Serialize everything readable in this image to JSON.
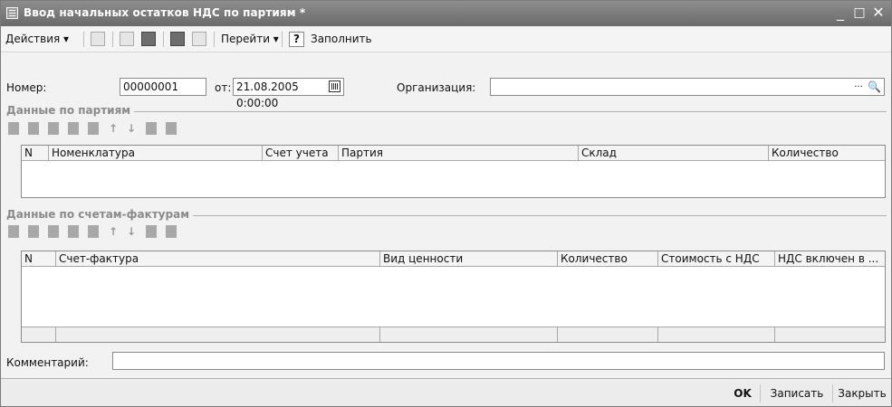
{
  "window": {
    "title": "Ввод начальных остатков НДС по партиям *",
    "minimize": "_",
    "maximize": "□",
    "close": "✕"
  },
  "toolbar": {
    "actions_label": "Действия ▾",
    "goto_label": "Перейти ▾",
    "help_label": "?",
    "fill_label": "Заполнить"
  },
  "header": {
    "number_label": "Номер:",
    "number_value": "00000001",
    "date_label": "от:",
    "date_value": "21.08.2005  0:00:00",
    "org_label": "Организация:",
    "org_value": "",
    "org_select": "...",
    "org_open": "🔍"
  },
  "batches": {
    "title": "Данные по партиям",
    "columns": [
      "N",
      "Номенклатура",
      "Счет учета",
      "Партия",
      "Склад",
      "Количество"
    ]
  },
  "invoices": {
    "title": "Данные по счетам-фактурам",
    "columns": [
      "N",
      "Счет-фактура",
      "Вид ценности",
      "Количество",
      "Стоимость с НДС",
      "НДС включен в ..."
    ]
  },
  "comment": {
    "label": "Комментарий:",
    "value": ""
  },
  "footer": {
    "ok_label": "OK",
    "save_label": "Записать",
    "close_label": "Закрыть"
  }
}
